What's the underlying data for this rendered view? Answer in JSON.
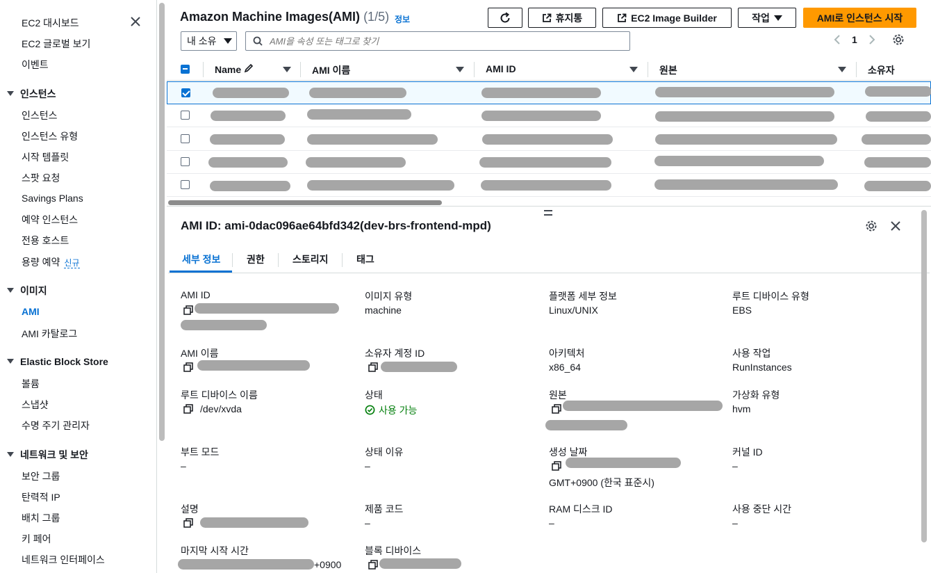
{
  "sidebar": {
    "items_top": [
      {
        "label": "EC2 대시보드"
      },
      {
        "label": "EC2 글로벌 보기"
      },
      {
        "label": "이벤트"
      }
    ],
    "sections": [
      {
        "title": "인스턴스",
        "items": [
          "인스턴스",
          "인스턴스 유형",
          "시작 템플릿",
          "스팟 요청",
          "Savings Plans",
          "예약 인스턴스",
          "전용 호스트",
          "용량 예약"
        ]
      },
      {
        "title": "이미지",
        "items": [
          "AMI",
          "AMI 카탈로그"
        ]
      },
      {
        "title": "Elastic Block Store",
        "items": [
          "볼륨",
          "스냅샷",
          "수명 주기 관리자"
        ]
      },
      {
        "title": "네트워크 및 보안",
        "items": [
          "보안 그룹",
          "탄력적 IP",
          "배치 그룹",
          "키 페어",
          "네트워크 인터페이스"
        ]
      }
    ],
    "new_badge": "신규",
    "active_item": "AMI"
  },
  "header": {
    "title": "Amazon Machine Images(AMI)",
    "count": "(1/5)",
    "info": "정보",
    "buttons": {
      "recycle_bin": "휴지통",
      "image_builder": "EC2 Image Builder",
      "actions": "작업",
      "launch": "AMI로 인스턴스 시작"
    },
    "owner_filter": "내 소유",
    "search_placeholder": "AMI을 속성 또는 태그로 찾기",
    "page": "1"
  },
  "table": {
    "columns": [
      "Name",
      "AMI 이름",
      "AMI ID",
      "원본",
      "소유자"
    ],
    "rows": [
      {
        "selected": true
      },
      {
        "selected": false
      },
      {
        "selected": false
      },
      {
        "selected": false
      },
      {
        "selected": false
      }
    ]
  },
  "detail": {
    "title": "AMI ID: ami-0dac096ae64bfd342(dev-brs-frontend-mpd)",
    "tabs": [
      "세부 정보",
      "권한",
      "스토리지",
      "태그"
    ],
    "fields": {
      "ami_id": "AMI ID",
      "image_type": "이미지 유형",
      "image_type_value": "machine",
      "platform": "플랫폼 세부 정보",
      "platform_value": "Linux/UNIX",
      "root_device_type": "루트 디바이스 유형",
      "root_device_type_value": "EBS",
      "ami_name": "AMI 이름",
      "owner_account": "소유자 계정 ID",
      "architecture": "아키텍처",
      "architecture_value": "x86_64",
      "usage_operation": "사용 작업",
      "usage_operation_value": "RunInstances",
      "root_device_name": "루트 디바이스 이름",
      "root_device_name_value": "/dev/xvda",
      "state": "상태",
      "state_value": "사용 가능",
      "source": "원본",
      "virtualization": "가상화 유형",
      "virtualization_value": "hvm",
      "boot_mode": "부트 모드",
      "boot_mode_value": "–",
      "state_reason": "상태 이유",
      "state_reason_value": "–",
      "creation_date": "생성 날짜",
      "creation_date_value": "GMT+0900 (한국 표준시)",
      "kernel_id": "커널 ID",
      "kernel_id_value": "–",
      "description": "설명",
      "product_code": "제품 코드",
      "product_code_value": "–",
      "ram_disk": "RAM 디스크 ID",
      "ram_disk_value": "–",
      "deprecation": "사용 중단 시간",
      "deprecation_value": "–",
      "last_launch": "마지막 시작 시간",
      "last_launch_suffix": "+0900",
      "block_devices": "블록 디바이스"
    }
  },
  "colors": {
    "accent": "#0972d3",
    "primary_button": "#ff9900",
    "success": "#037f0c"
  }
}
